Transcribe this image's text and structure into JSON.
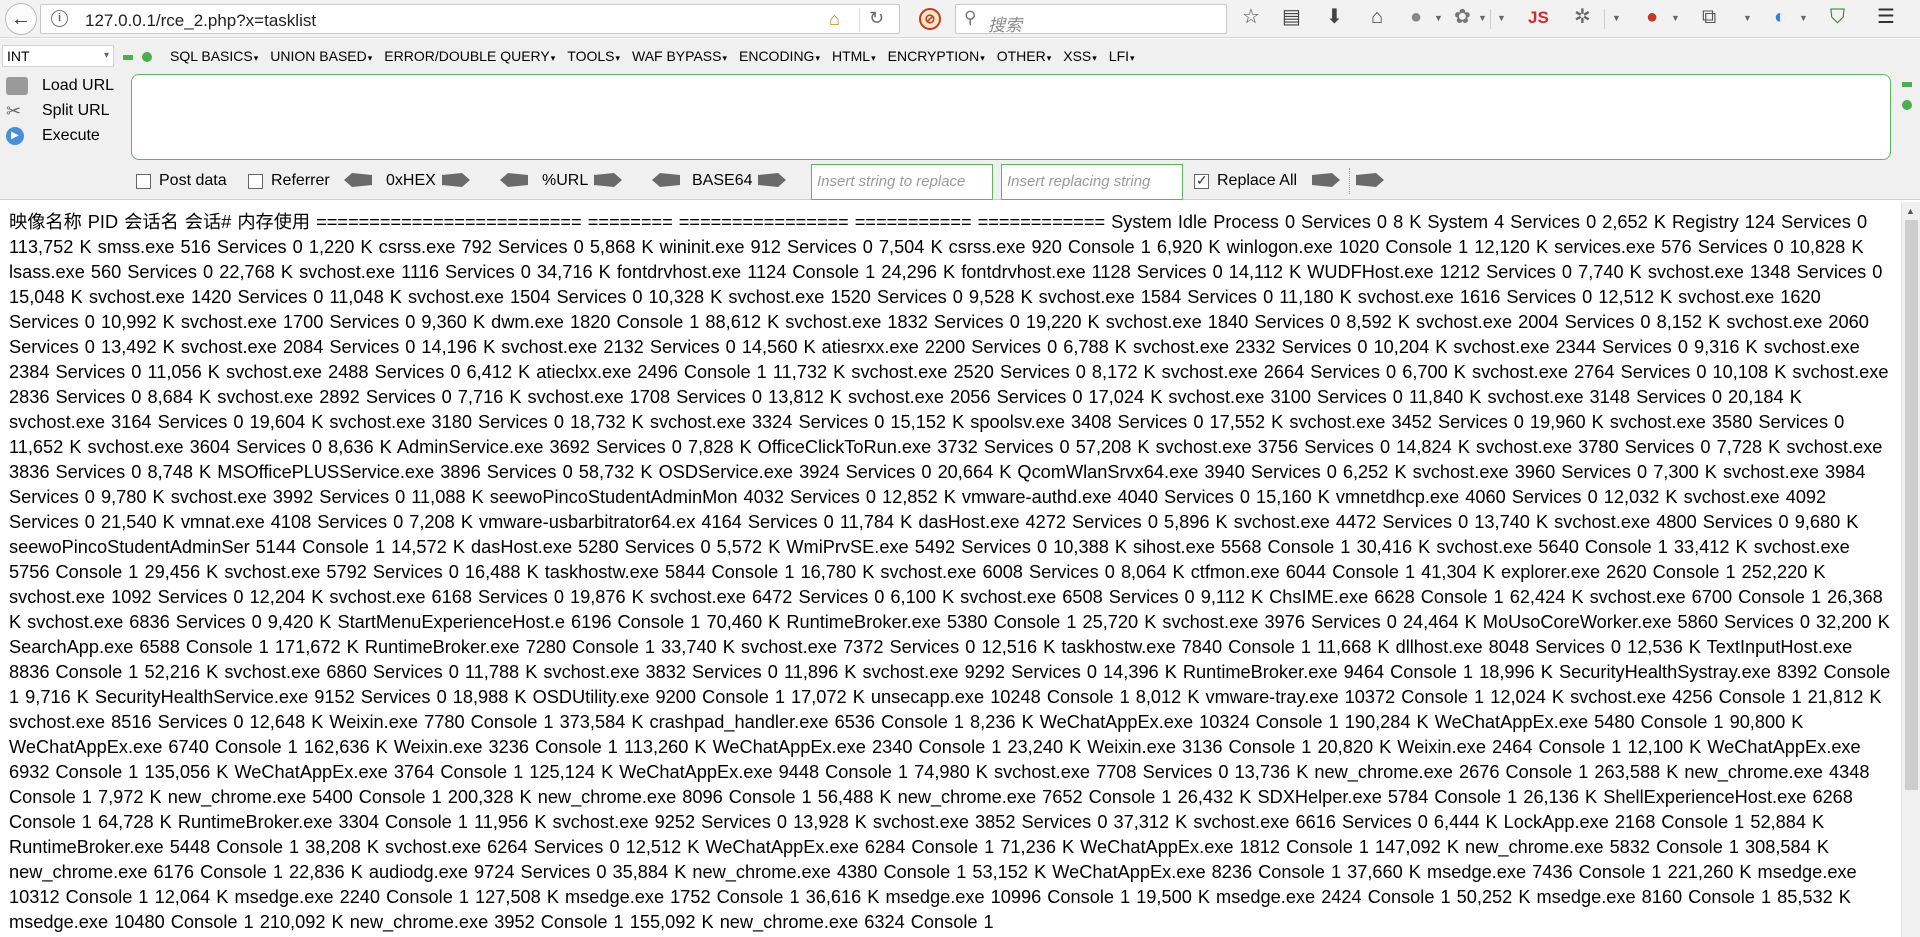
{
  "browser": {
    "url": "127.0.0.1/rce_2.php?x=tasklist",
    "search_placeholder": "搜索"
  },
  "hackbar": {
    "type_select": "INT",
    "menus": [
      "SQL BASICS",
      "UNION BASED",
      "ERROR/DOUBLE QUERY",
      "TOOLS",
      "WAF BYPASS",
      "ENCODING",
      "HTML",
      "ENCRYPTION",
      "OTHER",
      "XSS",
      "LFI"
    ],
    "actions": {
      "load_url": "Load URL",
      "split_url": "Split URL",
      "execute": "Execute"
    },
    "options": {
      "post_data": "Post data",
      "referrer": "Referrer",
      "hex": "0xHEX",
      "url_enc": "%URL",
      "base64": "BASE64",
      "insert_string_placeholder": "Insert string to replace",
      "insert_replacing_placeholder": "Insert replacing string",
      "replace_all": "Replace All",
      "replace_all_checked": true
    },
    "accent_color": "#5cb85c"
  },
  "page": {
    "output": "映像名称 PID 会话名 会话# 内存使用 ========================= ======== ================ =========== ============ System Idle Process 0 Services 0 8 K System 4 Services 0 2,652 K Registry 124 Services 0 113,752 K smss.exe 516 Services 0 1,220 K csrss.exe 792 Services 0 5,868 K wininit.exe 912 Services 0 7,504 K csrss.exe 920 Console 1 6,920 K winlogon.exe 1020 Console 1 12,120 K services.exe 576 Services 0 10,828 K lsass.exe 560 Services 0 22,768 K svchost.exe 1116 Services 0 34,716 K fontdrvhost.exe 1124 Console 1 24,296 K fontdrvhost.exe 1128 Services 0 14,112 K WUDFHost.exe 1212 Services 0 7,740 K svchost.exe 1348 Services 0 15,048 K svchost.exe 1420 Services 0 11,048 K svchost.exe 1504 Services 0 10,328 K svchost.exe 1520 Services 0 9,528 K svchost.exe 1584 Services 0 11,180 K svchost.exe 1616 Services 0 12,512 K svchost.exe 1620 Services 0 10,992 K svchost.exe 1700 Services 0 9,360 K dwm.exe 1820 Console 1 88,612 K svchost.exe 1832 Services 0 19,220 K svchost.exe 1840 Services 0 8,592 K svchost.exe 2004 Services 0 8,152 K svchost.exe 2060 Services 0 13,492 K svchost.exe 2084 Services 0 14,196 K svchost.exe 2132 Services 0 14,560 K atiesrxx.exe 2200 Services 0 6,788 K svchost.exe 2332 Services 0 10,204 K svchost.exe 2344 Services 0 9,316 K svchost.exe 2384 Services 0 11,056 K svchost.exe 2488 Services 0 6,412 K atieclxx.exe 2496 Console 1 11,732 K svchost.exe 2520 Services 0 8,172 K svchost.exe 2664 Services 0 6,700 K svchost.exe 2764 Services 0 10,108 K svchost.exe 2836 Services 0 8,684 K svchost.exe 2892 Services 0 7,716 K svchost.exe 1708 Services 0 13,812 K svchost.exe 2056 Services 0 17,024 K svchost.exe 3100 Services 0 11,840 K svchost.exe 3148 Services 0 20,184 K svchost.exe 3164 Services 0 19,604 K svchost.exe 3180 Services 0 18,732 K svchost.exe 3324 Services 0 15,152 K spoolsv.exe 3408 Services 0 17,552 K svchost.exe 3452 Services 0 19,960 K svchost.exe 3580 Services 0 11,652 K svchost.exe 3604 Services 0 8,636 K AdminService.exe 3692 Services 0 7,828 K OfficeClickToRun.exe 3732 Services 0 57,208 K svchost.exe 3756 Services 0 14,824 K svchost.exe 3780 Services 0 7,728 K svchost.exe 3836 Services 0 8,748 K MSOfficePLUSService.exe 3896 Services 0 58,732 K OSDService.exe 3924 Services 0 20,664 K QcomWlanSrvx64.exe 3940 Services 0 6,252 K svchost.exe 3960 Services 0 7,300 K svchost.exe 3984 Services 0 9,780 K svchost.exe 3992 Services 0 11,088 K seewoPincoStudentAdminMon 4032 Services 0 12,852 K vmware-authd.exe 4040 Services 0 15,160 K vmnetdhcp.exe 4060 Services 0 12,032 K svchost.exe 4092 Services 0 21,540 K vmnat.exe 4108 Services 0 7,208 K vmware-usbarbitrator64.ex 4164 Services 0 11,784 K dasHost.exe 4272 Services 0 5,896 K svchost.exe 4472 Services 0 13,740 K svchost.exe 4800 Services 0 9,680 K seewoPincoStudentAdminSer 5144 Console 1 14,572 K dasHost.exe 5280 Services 0 5,572 K WmiPrvSE.exe 5492 Services 0 10,388 K sihost.exe 5568 Console 1 30,416 K svchost.exe 5640 Console 1 33,412 K svchost.exe 5756 Console 1 29,456 K svchost.exe 5792 Services 0 16,488 K taskhostw.exe 5844 Console 1 16,780 K svchost.exe 6008 Services 0 8,064 K ctfmon.exe 6044 Console 1 41,304 K explorer.exe 2620 Console 1 252,220 K svchost.exe 1092 Services 0 12,204 K svchost.exe 6168 Services 0 19,876 K svchost.exe 6472 Services 0 6,100 K svchost.exe 6508 Services 0 9,112 K ChsIME.exe 6628 Console 1 62,424 K svchost.exe 6700 Console 1 26,368 K svchost.exe 6836 Services 0 9,420 K StartMenuExperienceHost.e 6196 Console 1 70,460 K RuntimeBroker.exe 5380 Console 1 25,720 K svchost.exe 3976 Services 0 24,464 K MoUsoCoreWorker.exe 5860 Services 0 32,200 K SearchApp.exe 6588 Console 1 171,672 K RuntimeBroker.exe 7280 Console 1 33,740 K svchost.exe 7372 Services 0 12,516 K taskhostw.exe 7840 Console 1 11,668 K dllhost.exe 8048 Services 0 12,536 K TextInputHost.exe 8836 Console 1 52,216 K svchost.exe 6860 Services 0 11,788 K svchost.exe 3832 Services 0 11,896 K svchost.exe 9292 Services 0 14,396 K RuntimeBroker.exe 9464 Console 1 18,996 K SecurityHealthSystray.exe 8392 Console 1 9,716 K SecurityHealthService.exe 9152 Services 0 18,988 K OSDUtility.exe 9200 Console 1 17,072 K unsecapp.exe 10248 Console 1 8,012 K vmware-tray.exe 10372 Console 1 12,024 K svchost.exe 4256 Console 1 21,812 K svchost.exe 8516 Services 0 12,648 K Weixin.exe 7780 Console 1 373,584 K crashpad_handler.exe 6536 Console 1 8,236 K WeChatAppEx.exe 10324 Console 1 190,284 K WeChatAppEx.exe 5480 Console 1 90,800 K WeChatAppEx.exe 6740 Console 1 162,636 K Weixin.exe 3236 Console 1 113,260 K WeChatAppEx.exe 2340 Console 1 23,240 K Weixin.exe 3136 Console 1 20,820 K Weixin.exe 2464 Console 1 12,100 K WeChatAppEx.exe 6932 Console 1 135,056 K WeChatAppEx.exe 3764 Console 1 125,124 K WeChatAppEx.exe 9448 Console 1 74,980 K svchost.exe 7708 Services 0 13,736 K new_chrome.exe 2676 Console 1 263,588 K new_chrome.exe 4348 Console 1 7,972 K new_chrome.exe 5400 Console 1 200,328 K new_chrome.exe 8096 Console 1 56,488 K new_chrome.exe 7652 Console 1 26,432 K SDXHelper.exe 5784 Console 1 26,136 K ShellExperienceHost.exe 6268 Console 1 64,728 K RuntimeBroker.exe 3304 Console 1 11,956 K svchost.exe 9252 Services 0 13,928 K svchost.exe 3852 Services 0 37,312 K svchost.exe 6616 Services 0 6,444 K LockApp.exe 2168 Console 1 52,884 K RuntimeBroker.exe 5448 Console 1 38,208 K svchost.exe 6264 Services 0 12,512 K WeChatAppEx.exe 6284 Console 1 71,236 K WeChatAppEx.exe 1812 Console 1 147,092 K new_chrome.exe 5832 Console 1 308,584 K new_chrome.exe 6176 Console 1 22,836 K audiodg.exe 9724 Services 0 35,884 K new_chrome.exe 4380 Console 1 53,152 K WeChatAppEx.exe 8236 Console 1 37,660 K msedge.exe 7436 Console 1 221,260 K msedge.exe 10312 Console 1 12,064 K msedge.exe 2240 Console 1 127,508 K msedge.exe 1752 Console 1 36,616 K msedge.exe 10996 Console 1 19,500 K msedge.exe 2424 Console 1 50,252 K msedge.exe 8160 Console 1 85,532 K msedge.exe 10480 Console 1 210,092 K new_chrome.exe 3952 Console 1 155,092 K new_chrome.exe 6324 Console 1"
  }
}
